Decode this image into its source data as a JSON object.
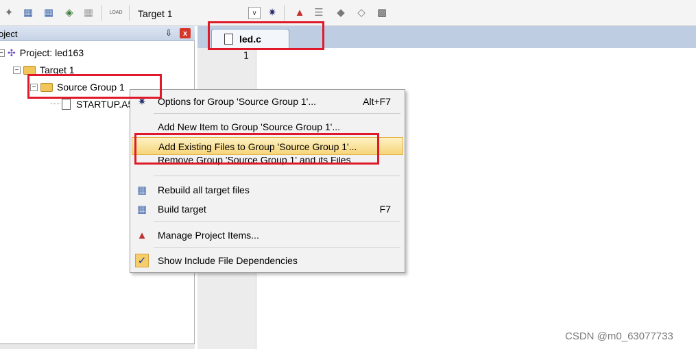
{
  "toolbar": {
    "target_name": "Target 1",
    "load_icon_text": "LOAD"
  },
  "project_panel": {
    "title": "oject",
    "pin_glyph": "⇩",
    "close_glyph": "x",
    "tree": {
      "project_label": "Project: led163",
      "target_label": "Target 1",
      "group_label": "Source Group 1",
      "file_label": "STARTUP.A5"
    }
  },
  "editor": {
    "tab_label": "led.c",
    "line_number": "1"
  },
  "context_menu": {
    "items": [
      {
        "label": "Options for Group 'Source Group 1'...",
        "shortcut": "Alt+F7",
        "icon": "options-icon"
      },
      {
        "label": "Add New  Item to Group 'Source Group 1'...",
        "shortcut": "",
        "icon": ""
      },
      {
        "label": "Add Existing Files to Group 'Source Group 1'...",
        "shortcut": "",
        "icon": ""
      },
      {
        "label": "Remove Group 'Source Group 1' and its Files",
        "shortcut": "",
        "icon": ""
      },
      {
        "label": "Rebuild all target files",
        "shortcut": "",
        "icon": "rebuild-icon"
      },
      {
        "label": "Build target",
        "shortcut": "F7",
        "icon": "build-icon"
      },
      {
        "label": "Manage Project Items...",
        "shortcut": "",
        "icon": "manage-items-icon"
      },
      {
        "label": "Show Include File Dependencies",
        "shortcut": "",
        "icon": "checkmark-icon"
      }
    ],
    "check_glyph": "✓"
  },
  "watermark": "CSDN @m0_63077733",
  "colors": {
    "annotation_red": "#e0192a",
    "highlight_gold": "#f6d57a",
    "panel_header_blue": "#c7d3e6"
  }
}
